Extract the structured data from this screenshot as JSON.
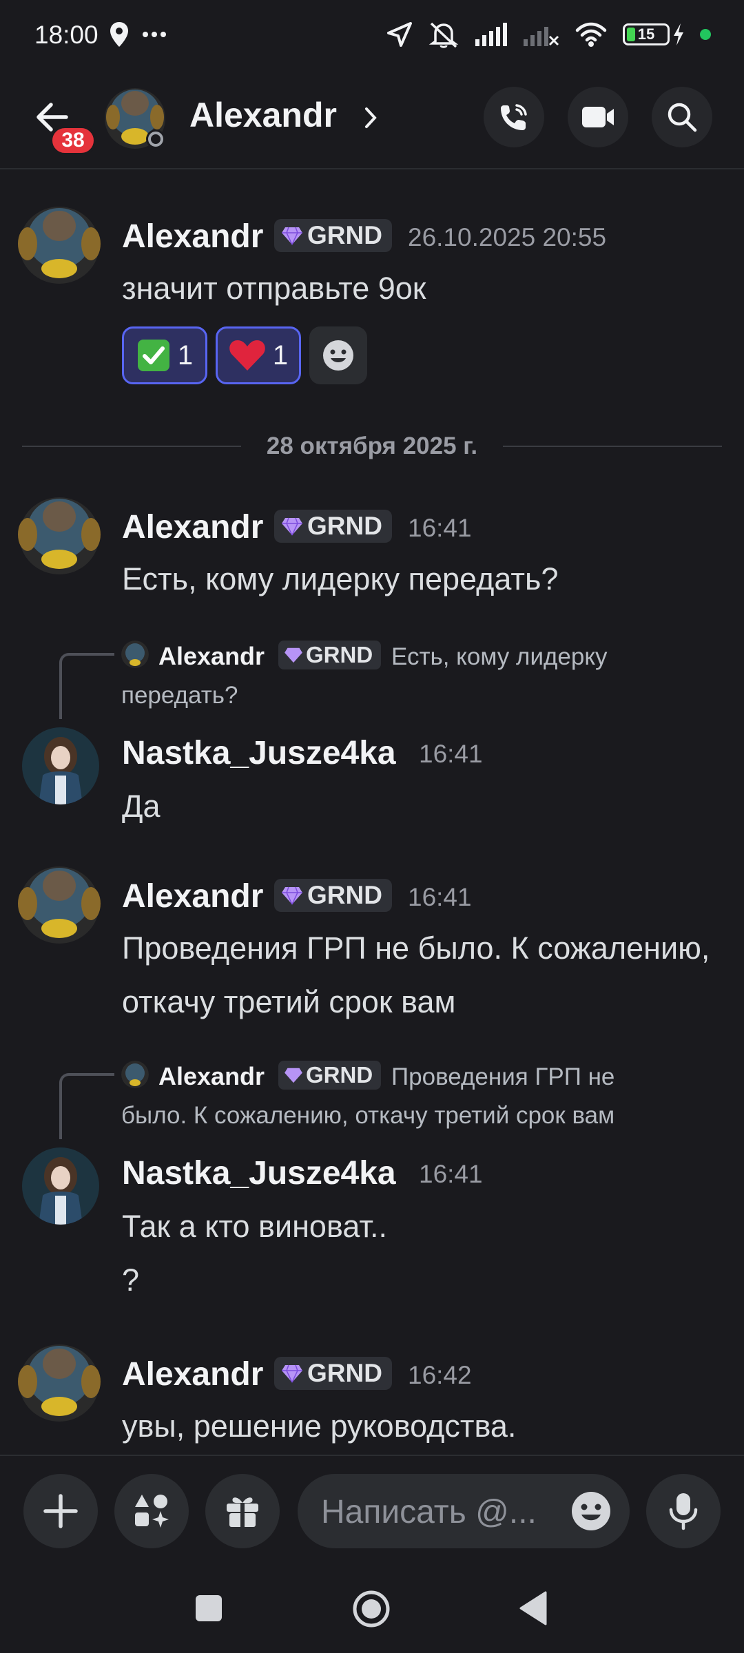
{
  "status_bar": {
    "time": "18:00",
    "battery_level": "15"
  },
  "header": {
    "unread_count": "38",
    "title": "Alexandr"
  },
  "messages": [
    {
      "author": "Alexandr",
      "tag": "GRND",
      "time": "26.10.2025 20:55",
      "text": "значит отправьте 9ок",
      "reactions": [
        {
          "emoji": "✅",
          "count": "1"
        },
        {
          "emoji": "❤️",
          "count": "1"
        }
      ]
    },
    {
      "author": "Alexandr",
      "tag": "GRND",
      "time": "16:41",
      "text": "Есть, кому лидерку передать?"
    },
    {
      "reply": {
        "author": "Alexandr",
        "tag": "GRND",
        "text": "Есть, кому лидерку передать?"
      },
      "author": "Nastka_Jusze4ka",
      "time": "16:41",
      "text": "Да"
    },
    {
      "author": "Alexandr",
      "tag": "GRND",
      "time": "16:41",
      "text": "Проведения ГРП не было. К сожалению, откачу третий срок вам"
    },
    {
      "reply": {
        "author": "Alexandr",
        "tag": "GRND",
        "text": "Проведения ГРП не было. К сожалению, откачу третий срок вам"
      },
      "author": "Nastka_Jusze4ka",
      "time": "16:41",
      "text_line1": "Так а кто виноват..",
      "text_line2": "?"
    },
    {
      "author": "Alexandr",
      "tag": "GRND",
      "time": "16:42",
      "text": "увы, решение руководства."
    }
  ],
  "date_divider": "28 октября 2025 г.",
  "composer": {
    "placeholder": "Написать @..."
  },
  "icons": {
    "tag_icon": "gem-icon",
    "accent_color": "#5865f2",
    "badge_color": "#e5333b"
  }
}
